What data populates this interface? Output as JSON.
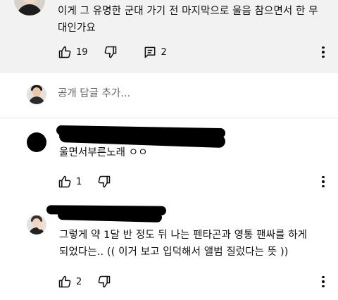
{
  "top_comment": {
    "text": "이게 그 유명한 군대 가기 전 마지막으로 울음 참으면서 한 무대인가요",
    "likes": "19",
    "replies": "2"
  },
  "add_comment": {
    "placeholder": "공개 답글 추가..."
  },
  "replies": [
    {
      "text": "울면서부른노래 ㅇㅇ",
      "likes": "1"
    },
    {
      "text": "그렇게 약 1달 반 정도 뒤 나는 펜타곤과 영통 팬싸를 하게 되었다는.. (( 이거 보고 입덕해서 앨범 질렀다는 뜻 ))",
      "likes": "2"
    }
  ],
  "icons": {
    "like": "thumbs-up-icon",
    "dislike": "thumbs-down-icon",
    "reply": "reply-comment-icon",
    "more": "more-vertical-icon"
  }
}
